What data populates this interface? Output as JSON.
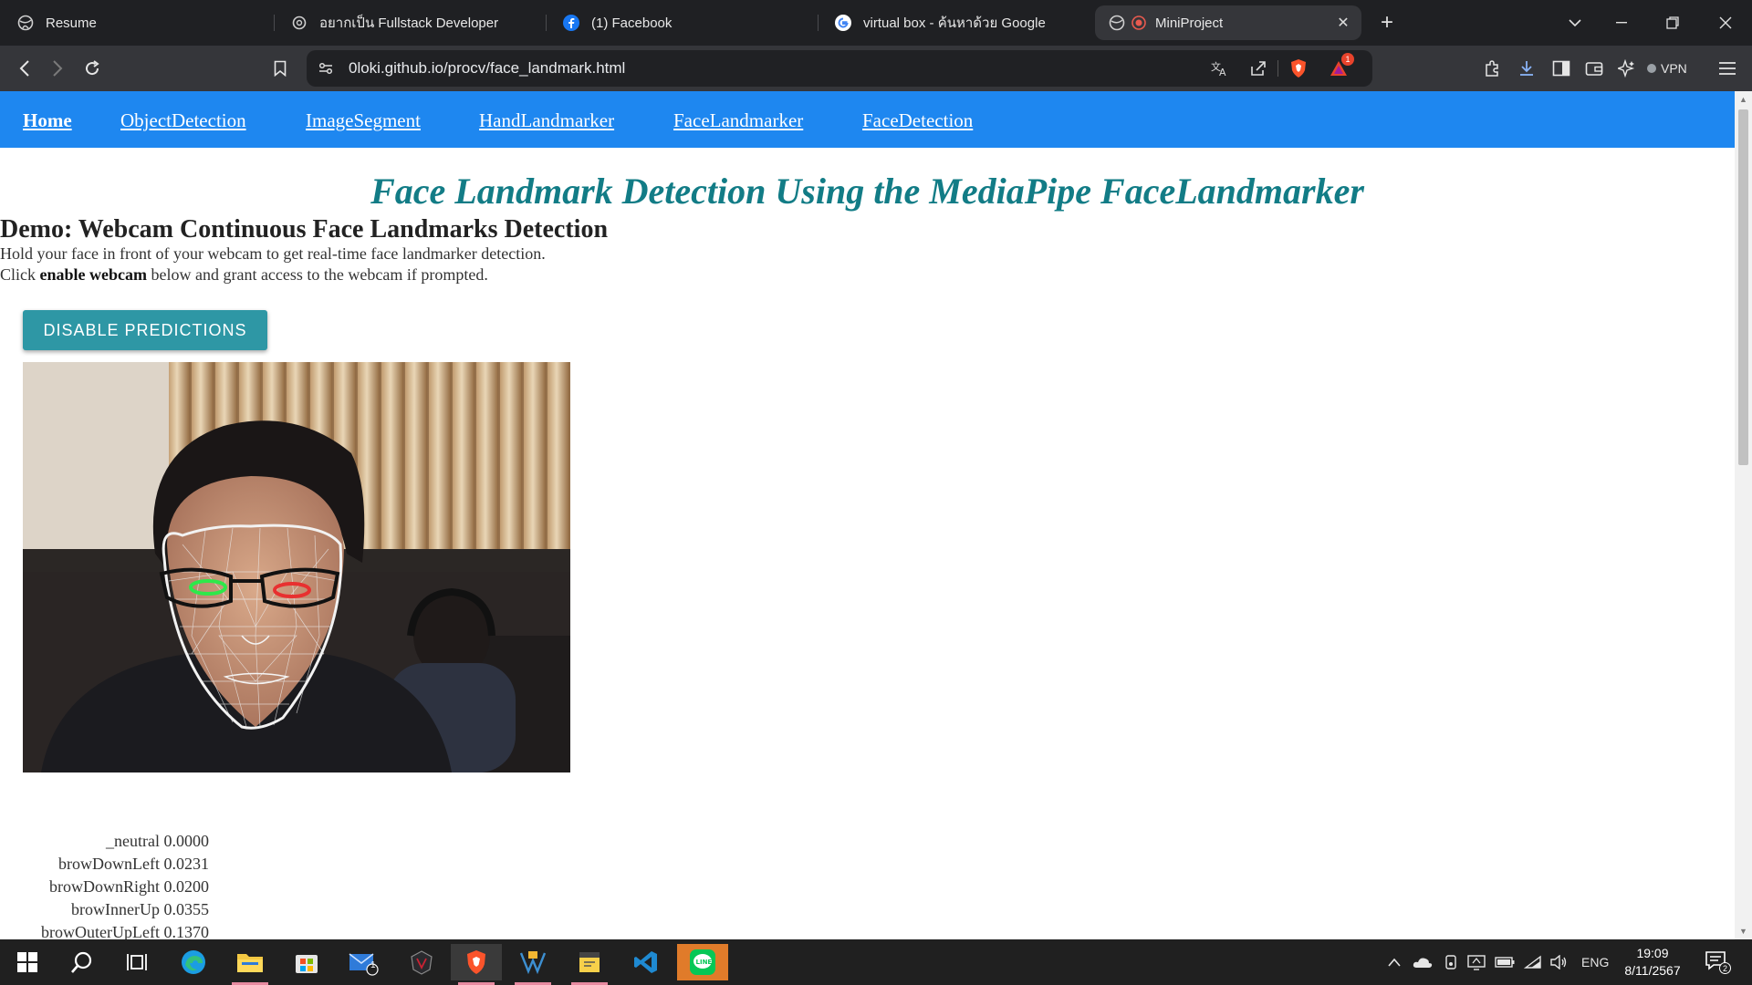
{
  "browser": {
    "tabs": [
      {
        "label": "Resume",
        "active": false
      },
      {
        "label": "อยากเป็น Fullstack Developer",
        "active": false
      },
      {
        "label": "(1) Facebook",
        "active": false
      },
      {
        "label": "virtual box - ค้นหาด้วย Google",
        "active": false
      },
      {
        "label": "MiniProject",
        "active": true
      }
    ],
    "url": "0loki.github.io/procv/face_landmark.html",
    "vpn_label": "VPN",
    "alert_count": "1"
  },
  "site": {
    "nav": [
      {
        "label": "Home"
      },
      {
        "label": "ObjectDetection"
      },
      {
        "label": "ImageSegment"
      },
      {
        "label": "HandLandmarker"
      },
      {
        "label": "FaceLandmarker"
      },
      {
        "label": "FaceDetection"
      }
    ],
    "title": "Face Landmark Detection Using the MediaPipe FaceLandmarker",
    "demo_heading": "Demo: Webcam Continuous Face Landmarks Detection",
    "instruction_1": "Hold your face in front of your webcam to get real-time face landmarker detection.",
    "instruction_2_pre": "Click ",
    "instruction_2_bold": "enable webcam",
    "instruction_2_post": " below and grant access to the webcam if prompted.",
    "predictions_button": "DISABLE PREDICTIONS",
    "blendshapes": [
      {
        "name": "_neutral",
        "score": "0.0000"
      },
      {
        "name": "browDownLeft",
        "score": "0.0231"
      },
      {
        "name": "browDownRight",
        "score": "0.0200"
      },
      {
        "name": "browInnerUp",
        "score": "0.0355"
      },
      {
        "name": "browOuterUpLeft",
        "score": "0.1370"
      }
    ]
  },
  "taskbar": {
    "language": "ENG",
    "time": "19:09",
    "date": "8/11/2567",
    "mail_badge": "1",
    "notification_count": "2"
  },
  "colors": {
    "nav_bar": "#1e87f0",
    "title": "#127c86",
    "button": "#2e97a5",
    "left_eye_overlay": "#2ee84a",
    "right_eye_overlay": "#e83030"
  }
}
